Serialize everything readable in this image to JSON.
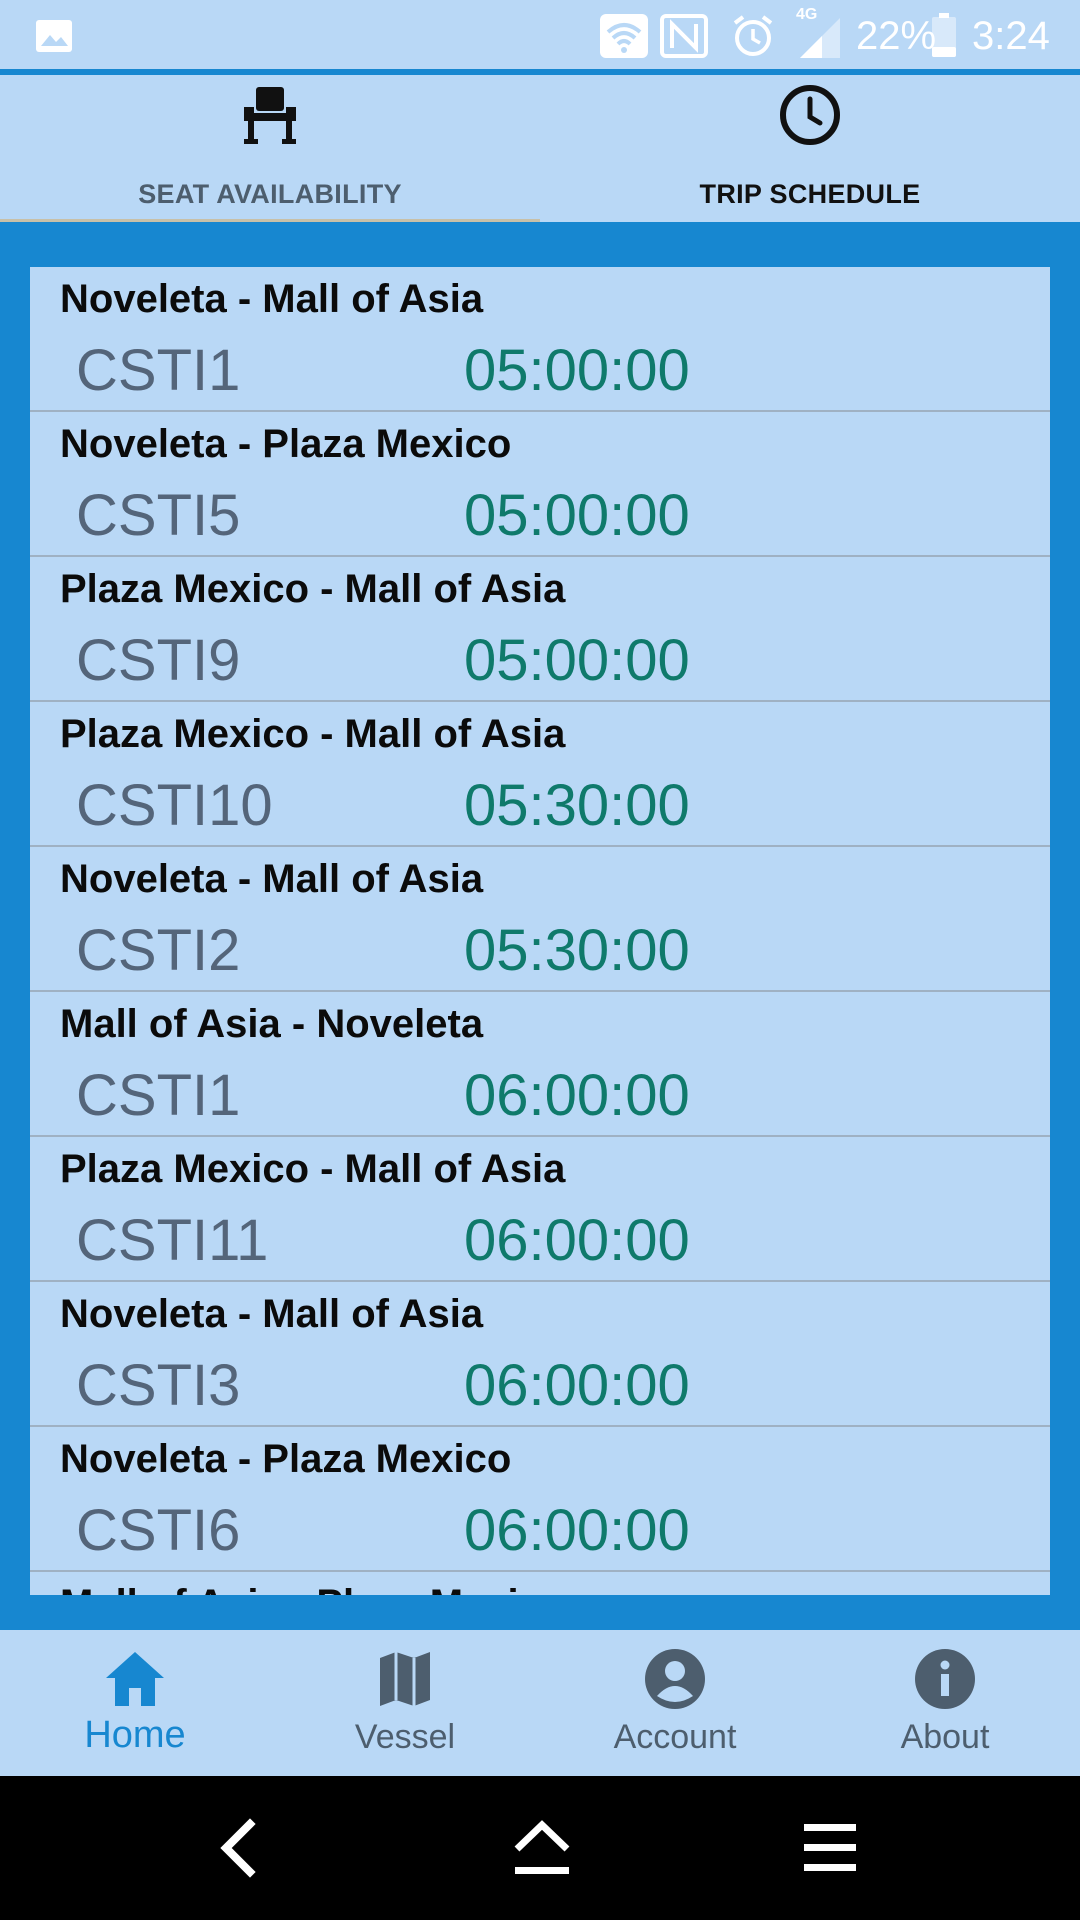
{
  "status_bar": {
    "battery": "22%",
    "time": "3:24",
    "network": "4G"
  },
  "tabs": [
    {
      "label": "SEAT AVAILABILITY",
      "icon": "seat-icon",
      "selected": false
    },
    {
      "label": "TRIP SCHEDULE",
      "icon": "clock-icon",
      "selected": true
    }
  ],
  "trips": [
    {
      "route": "Noveleta - Mall of Asia",
      "code": "CSTI1",
      "time": "05:00:00"
    },
    {
      "route": "Noveleta - Plaza Mexico",
      "code": "CSTI5",
      "time": "05:00:00"
    },
    {
      "route": "Plaza Mexico - Mall of Asia",
      "code": "CSTI9",
      "time": "05:00:00"
    },
    {
      "route": "Plaza Mexico - Mall of Asia",
      "code": "CSTI10",
      "time": "05:30:00"
    },
    {
      "route": "Noveleta - Mall of Asia",
      "code": "CSTI2",
      "time": "05:30:00"
    },
    {
      "route": "Mall of Asia - Noveleta",
      "code": "CSTI1",
      "time": "06:00:00"
    },
    {
      "route": "Plaza Mexico - Mall of Asia",
      "code": "CSTI11",
      "time": "06:00:00"
    },
    {
      "route": "Noveleta - Mall of Asia",
      "code": "CSTI3",
      "time": "06:00:00"
    },
    {
      "route": "Noveleta - Plaza Mexico",
      "code": "CSTI6",
      "time": "06:00:00"
    },
    {
      "route": "Mall of Asia - Plaza Mexico",
      "code": "",
      "time": ""
    }
  ],
  "bottom_nav": [
    {
      "label": "Home",
      "icon": "home-icon",
      "active": true
    },
    {
      "label": "Vessel",
      "icon": "map-icon",
      "active": false
    },
    {
      "label": "Account",
      "icon": "account-icon",
      "active": false
    },
    {
      "label": "About",
      "icon": "info-icon",
      "active": false
    }
  ],
  "colors": {
    "accent": "#1787d0",
    "panel": "#b9d8f6",
    "time_text": "#0f7a6b",
    "code_text": "#54657a",
    "inactive": "#4d5e6e"
  }
}
